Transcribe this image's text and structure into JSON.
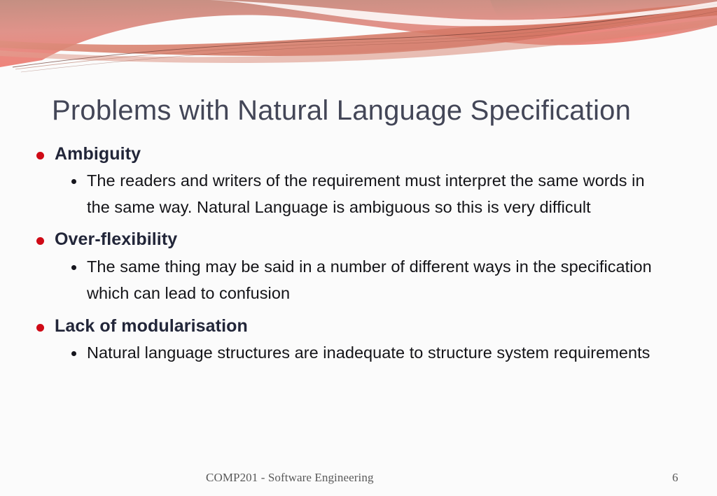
{
  "slide": {
    "title": "Problems with Natural Language Specification",
    "bullets": [
      {
        "label": "Ambiguity",
        "sub": [
          "The readers and writers of the requirement must interpret the same words in the same way. Natural Language is ambiguous so this is very difficult"
        ]
      },
      {
        "label": "Over-flexibility",
        "sub": [
          "The same thing may be said in a number of different ways in the specification which can lead to confusion"
        ]
      },
      {
        "label": "Lack of modularisation",
        "sub": [
          "Natural language structures are inadequate to structure system requirements"
        ]
      }
    ]
  },
  "footer": {
    "course": "COMP201 - Software Engineering",
    "slide_number": "6"
  },
  "theme": {
    "banner_gradient_top": "#c79184",
    "banner_gradient_bottom": "#ef8179",
    "banner_band_dark": "#d0705f",
    "banner_band_mid": "#e09387",
    "title_color": "#434657",
    "bullet_marker_color": "#cf0a16",
    "sub_marker_color": "#15151d",
    "heading_text_color": "#222639",
    "body_text_color": "#141418",
    "footer_text_color": "#595959",
    "page_background": "#fbfbfb"
  }
}
